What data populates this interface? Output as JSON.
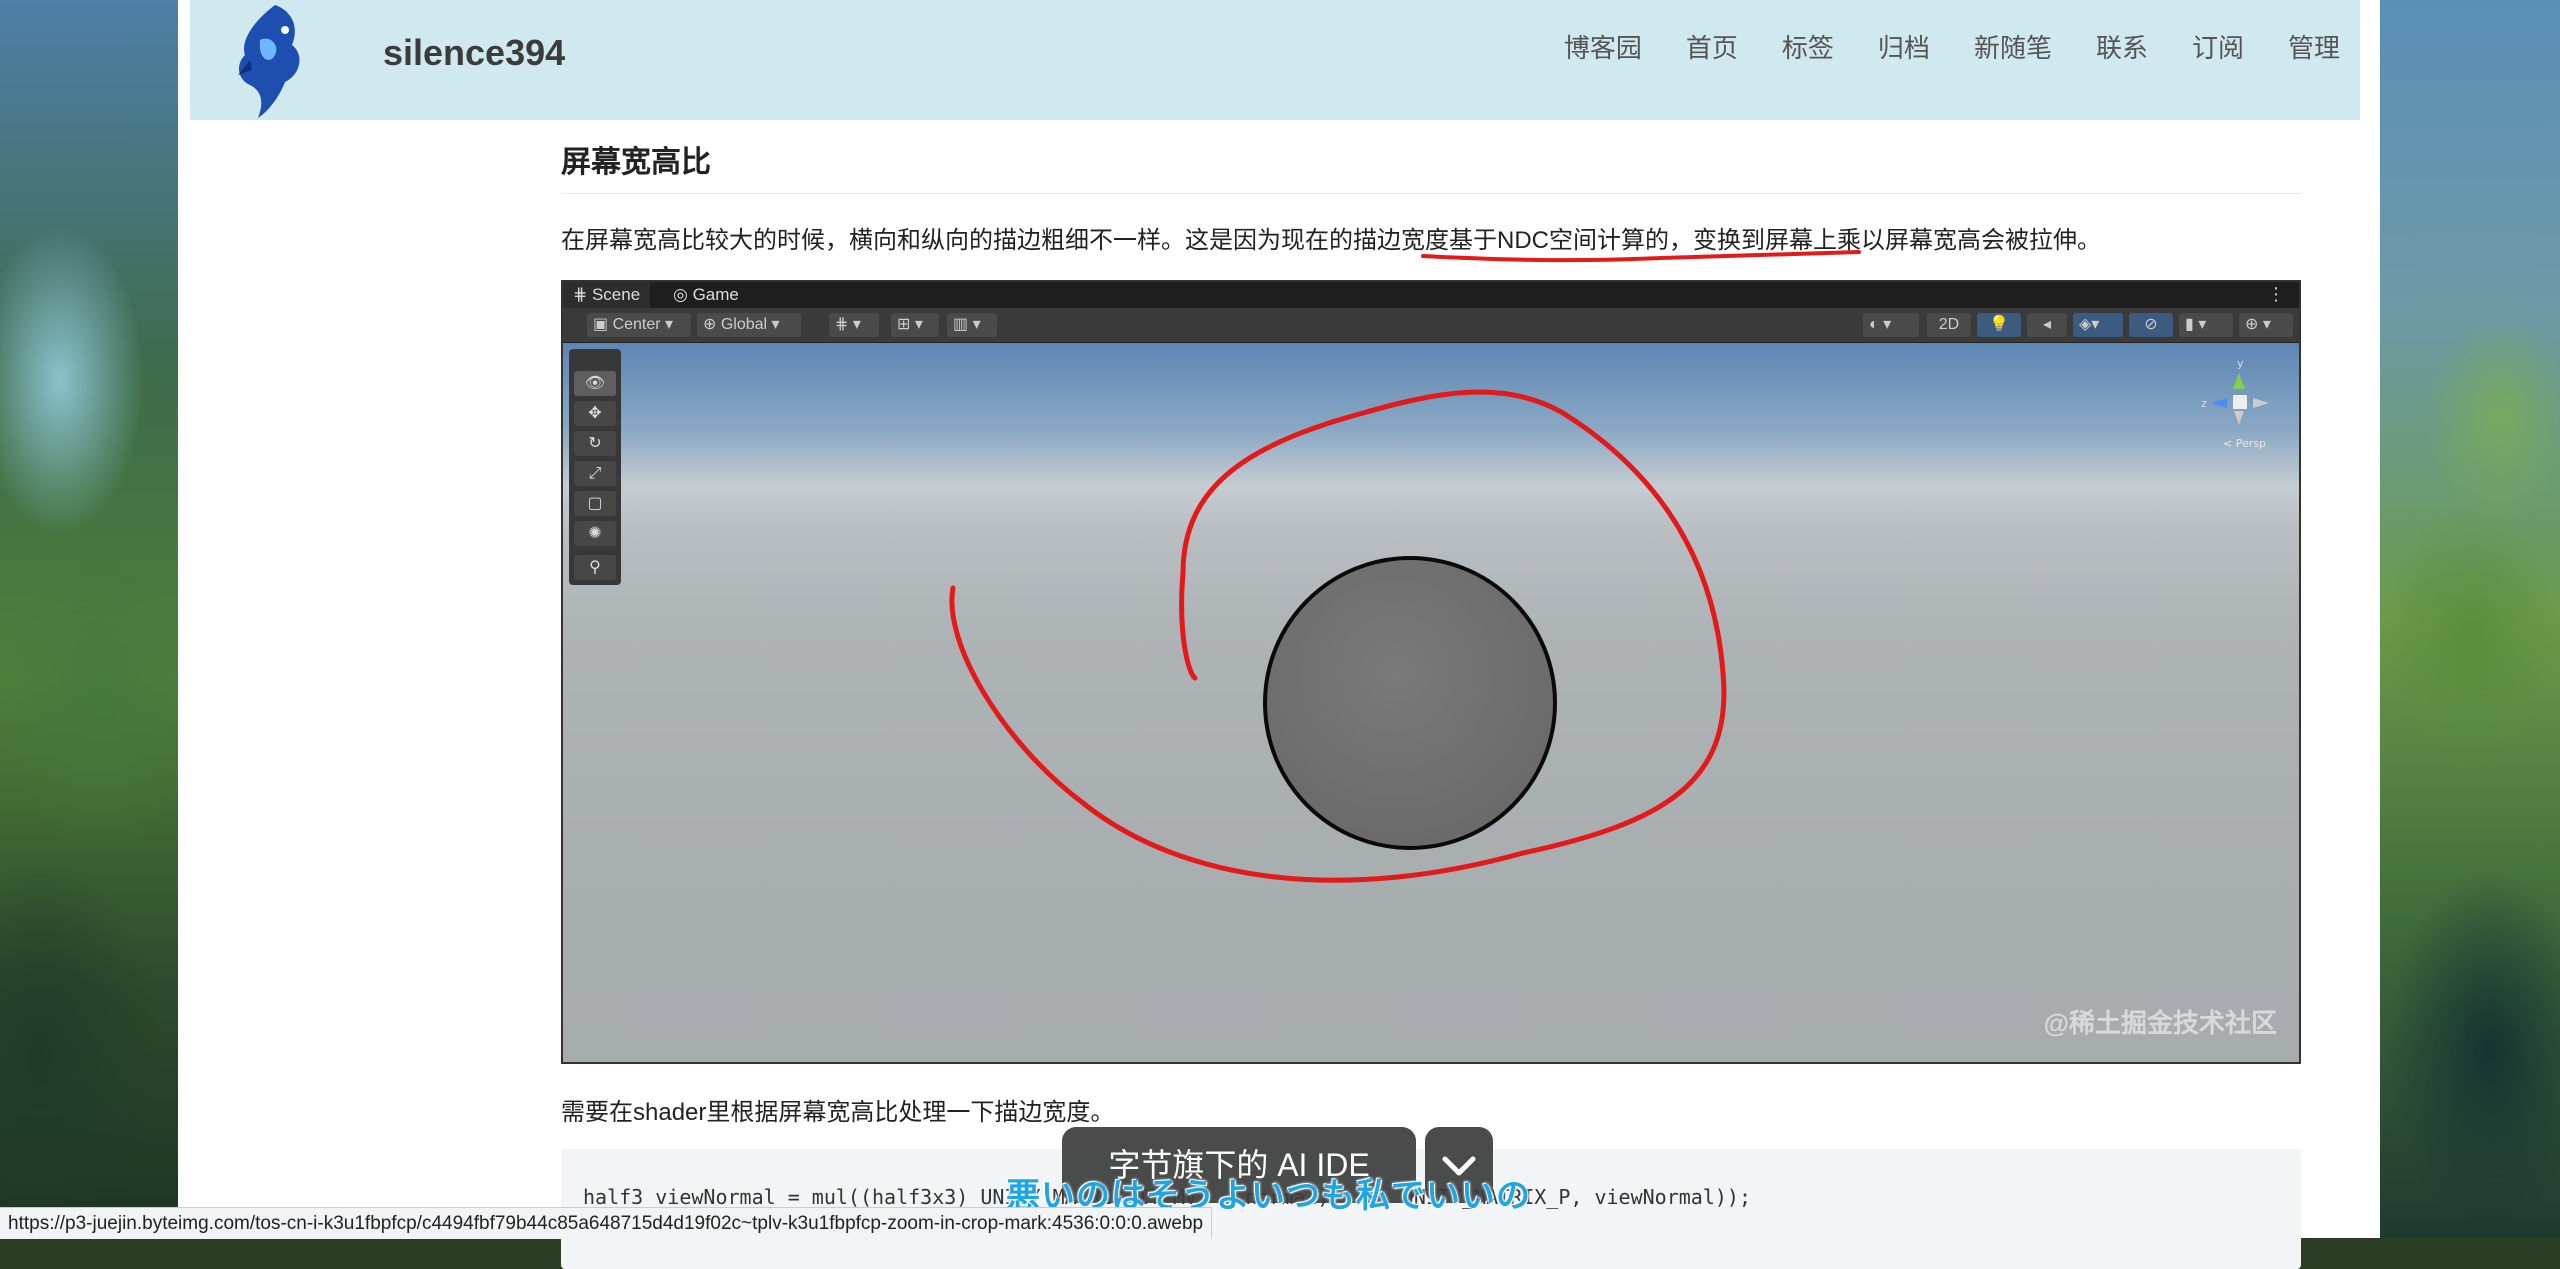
{
  "site": {
    "title": "silence394",
    "nav": [
      "博客园",
      "首页",
      "标签",
      "归档",
      "新随笔",
      "联系",
      "订阅",
      "管理"
    ]
  },
  "article": {
    "heading": "屏幕宽高比",
    "para1_a": "在屏幕宽高比较大的时候，横向和纵向的描边粗细不一样。这是因为现在的描边宽度基于NDC空间计算的，",
    "para1_b": "变换到屏幕上乘以屏幕宽高会被拉伸",
    "para1_c": "。",
    "para2": "需要在shader里根据屏幕宽高比处理一下描边宽度。",
    "code_line": "half3 viewNormal = mul((half3x3) UNITY_MATRIX_IT_MV, v.normal); ... UNITY_MATRIX_P, viewNormal));"
  },
  "unity": {
    "tabs": [
      "Scene",
      "Game"
    ],
    "toolbar": {
      "pivot": "Center",
      "space": "Global",
      "mode_2d": "2D"
    },
    "gizmo": {
      "y": "y",
      "z": "z",
      "persp": "< Persp"
    },
    "watermark": "@稀土掘金技术社区"
  },
  "overlay": {
    "button_label": "字节旗下的 AI IDE",
    "subtitle": "悪いのはそうよいつも私でいいの"
  },
  "status": {
    "url": "https://p3-juejin.byteimg.com/tos-cn-i-k3u1fbpfcp/c4494fbf79b44c85a648715d4d19f02c~tplv-k3u1fbpfcp-zoom-in-crop-mark:4536:0:0:0.awebp"
  },
  "colors": {
    "header_bg": "#cfe9ee",
    "annotation_red": "#e31a1a",
    "subtitle_blue": "#1ea5e6"
  }
}
